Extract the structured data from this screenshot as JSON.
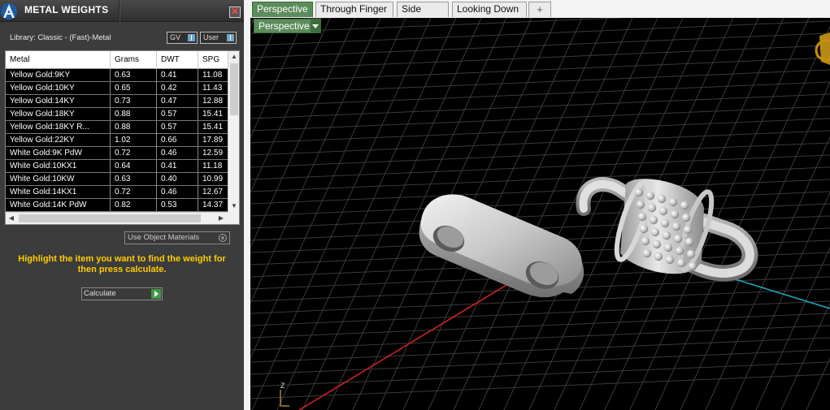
{
  "panel": {
    "title": "METAL WEIGHTS",
    "close_label": "✕",
    "library_label": "Library: Classic - (Fast)-Metal",
    "gv_label": "GV",
    "user_label": "User"
  },
  "table": {
    "columns": [
      "Metal",
      "Grams",
      "DWT",
      "SPG"
    ],
    "rows": [
      [
        "Yellow Gold:9KY",
        "0.63",
        "0.41",
        "11.08"
      ],
      [
        "Yellow Gold:10KY",
        "0.65",
        "0.42",
        "11.43"
      ],
      [
        "Yellow Gold:14KY",
        "0.73",
        "0.47",
        "12.88"
      ],
      [
        "Yellow Gold:18KY",
        "0.88",
        "0.57",
        "15.41"
      ],
      [
        "Yellow Gold:18KY R...",
        "0.88",
        "0.57",
        "15.41"
      ],
      [
        "Yellow Gold:22KY",
        "1.02",
        "0.66",
        "17.89"
      ],
      [
        "White Gold:9K PdW",
        "0.72",
        "0.46",
        "12.59"
      ],
      [
        "White Gold:10KX1",
        "0.64",
        "0.41",
        "11.18"
      ],
      [
        "White Gold:10KW",
        "0.63",
        "0.40",
        "10.99"
      ],
      [
        "White Gold:14KX1",
        "0.72",
        "0.46",
        "12.67"
      ],
      [
        "White Gold:14K PdW",
        "0.82",
        "0.53",
        "14.37"
      ]
    ],
    "scroll_up": "▲",
    "scroll_down": "▼",
    "scroll_left": "◀",
    "scroll_right": "▶"
  },
  "controls": {
    "use_object_materials": "Use Object Materials",
    "instruction": "Highlight the item you want to find the weight for then press calculate.",
    "calculate_label": "Calculate"
  },
  "viewport": {
    "tabs": [
      "Perspective",
      "Through Finger",
      "Side View",
      "Looking Down"
    ],
    "add_tab": "+",
    "active_tab": "Perspective",
    "view_dropdown": "Perspective",
    "axis_label": "Z"
  },
  "colors": {
    "panel_bg": "#3c3c3c",
    "accent_green": "#5c8c5c",
    "instruction_yellow": "#ffcc00",
    "grid_line": "#3a3a3a",
    "x_axis": "#d42020",
    "y_axis": "#1fa3b8"
  },
  "icons": {
    "app_logo": "blue-a-logo-icon",
    "close": "close-icon",
    "toggle_indicator": "toggle-icon",
    "radio": "radio-icon",
    "play": "play-arrow-icon",
    "dropdown": "chevron-down-icon",
    "view_cube": "view-cube-icon"
  }
}
